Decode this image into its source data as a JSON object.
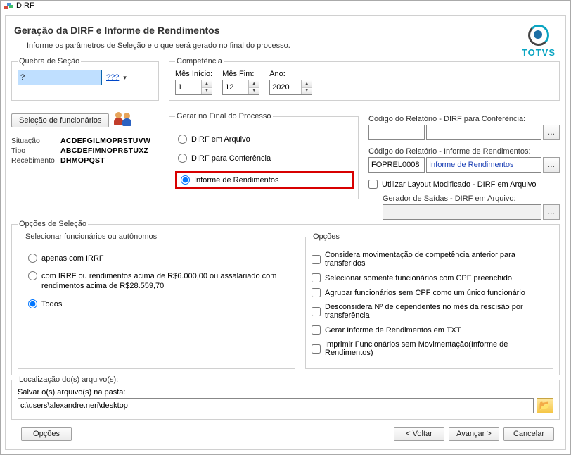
{
  "window": {
    "title": "DIRF"
  },
  "header": {
    "title": "Geração da DIRF e Informe de Rendimentos",
    "subtitle": "Informe os parâmetros de Seleção e o que será gerado no final do processo."
  },
  "logo": {
    "text": "TOTVS"
  },
  "quebra": {
    "legend": "Quebra de Seção",
    "value": "?",
    "lookup_label": "???"
  },
  "competencia": {
    "legend": "Competência",
    "mes_inicio_label": "Mês Início:",
    "mes_inicio": "1",
    "mes_fim_label": "Mês Fim:",
    "mes_fim": "12",
    "ano_label": "Ano:",
    "ano": "2020"
  },
  "selecao": {
    "button": "Seleção de funcionários",
    "situacao_label": "Situação",
    "situacao_value": "ACDEFGILMOPRSTUVW",
    "tipo_label": "Tipo",
    "tipo_value": "ABCDEFIMNOPRSTUXZ",
    "recebimento_label": "Recebimento",
    "recebimento_value": "DHMOPQST"
  },
  "gerar": {
    "legend": "Gerar no Final do Processo",
    "opt1": "DIRF em Arquivo",
    "opt2": "DIRF para Conferência",
    "opt3": "Informe de Rendimentos",
    "selected": "opt3"
  },
  "codigos": {
    "dirf_label": "Código do Relatório - DIRF para Conferência:",
    "dirf_code": "",
    "dirf_desc": "",
    "rend_label": "Código do Relatório - Informe de Rendimentos:",
    "rend_code": "FOPREL0008",
    "rend_desc": "Informe de Rendimentos",
    "layout_chk": "Utilizar Layout Modificado - DIRF em Arquivo",
    "gerador_label": "Gerador de Saídas - DIRF em Arquivo:"
  },
  "opcoes_selecao": {
    "legend": "Opções de Seleção",
    "sel_func_legend": "Selecionar funcionários ou autônomos",
    "r1": "apenas com IRRF",
    "r2": "com IRRF ou rendimentos acima de R$6.000,00 ou assalariado com rendimentos acima de R$28.559,70",
    "r3": "Todos",
    "selected": "r3",
    "opcoes_legend": "Opções",
    "c1": "Considera movimentação de competência anterior para transferidos",
    "c2": "Selecionar somente funcionários com CPF preenchido",
    "c3": "Agrupar funcionários sem CPF como um único funcionário",
    "c4": "Desconsidera Nº de dependentes no mês da rescisão por transferência",
    "c5": "Gerar Informe de Rendimentos em TXT",
    "c6": "Imprimir Funcionários sem Movimentação(Informe de Rendimentos)"
  },
  "localizacao": {
    "legend": "Localização do(s) arquivo(s):",
    "sub_label": "Salvar o(s) arquivo(s) na pasta:",
    "path": "c:\\users\\alexandre.neri\\desktop"
  },
  "footer": {
    "opcoes": "Opções",
    "voltar": "< Voltar",
    "avancar": "Avançar >",
    "cancelar": "Cancelar"
  }
}
